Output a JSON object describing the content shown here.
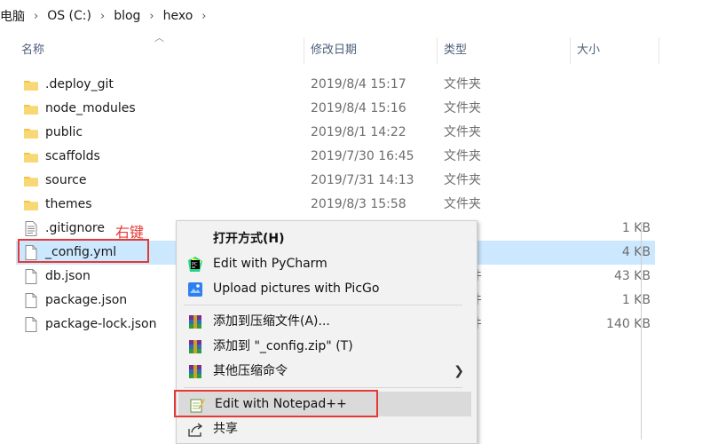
{
  "breadcrumb": [
    "电脑",
    "OS (C:)",
    "blog",
    "hexo"
  ],
  "headers": {
    "name": "名称",
    "date": "修改日期",
    "type": "类型",
    "size": "大小"
  },
  "files": [
    {
      "name": ".deploy_git",
      "date": "2019/8/4 15:17",
      "type": "文件夹",
      "size": "",
      "kind": "folder"
    },
    {
      "name": "node_modules",
      "date": "2019/8/4 15:16",
      "type": "文件夹",
      "size": "",
      "kind": "folder"
    },
    {
      "name": "public",
      "date": "2019/8/1 14:22",
      "type": "文件夹",
      "size": "",
      "kind": "folder"
    },
    {
      "name": "scaffolds",
      "date": "2019/7/30 16:45",
      "type": "文件夹",
      "size": "",
      "kind": "folder"
    },
    {
      "name": "source",
      "date": "2019/7/31 14:13",
      "type": "文件夹",
      "size": "",
      "kind": "folder"
    },
    {
      "name": "themes",
      "date": "2019/8/3 15:58",
      "type": "文件夹",
      "size": "",
      "kind": "folder"
    },
    {
      "name": ".gitignore",
      "date": "",
      "type": "文档",
      "size": "1 KB",
      "kind": "file"
    },
    {
      "name": "_config.yml",
      "date": "",
      "type": "文件",
      "size": "4 KB",
      "kind": "file"
    },
    {
      "name": "db.json",
      "date": "",
      "type": "N 文件",
      "size": "43 KB",
      "kind": "file"
    },
    {
      "name": "package.json",
      "date": "",
      "type": "N 文件",
      "size": "1 KB",
      "kind": "file"
    },
    {
      "name": "package-lock.json",
      "date": "",
      "type": "N 文件",
      "size": "140 KB",
      "kind": "file"
    }
  ],
  "annotation": "右键",
  "context_menu": {
    "open_with": "打开方式(H)",
    "pycharm": "Edit with PyCharm",
    "picgo": "Upload pictures with PicGo",
    "add_archive": "添加到压缩文件(A)...",
    "add_zip": "添加到 \"_config.zip\" (T)",
    "other_compress": "其他压缩命令",
    "notepad": "Edit with Notepad++",
    "share": "共享"
  },
  "colors": {
    "selection": "#cce8ff",
    "highlight_box": "#e53935",
    "folder": "#f4c542"
  }
}
